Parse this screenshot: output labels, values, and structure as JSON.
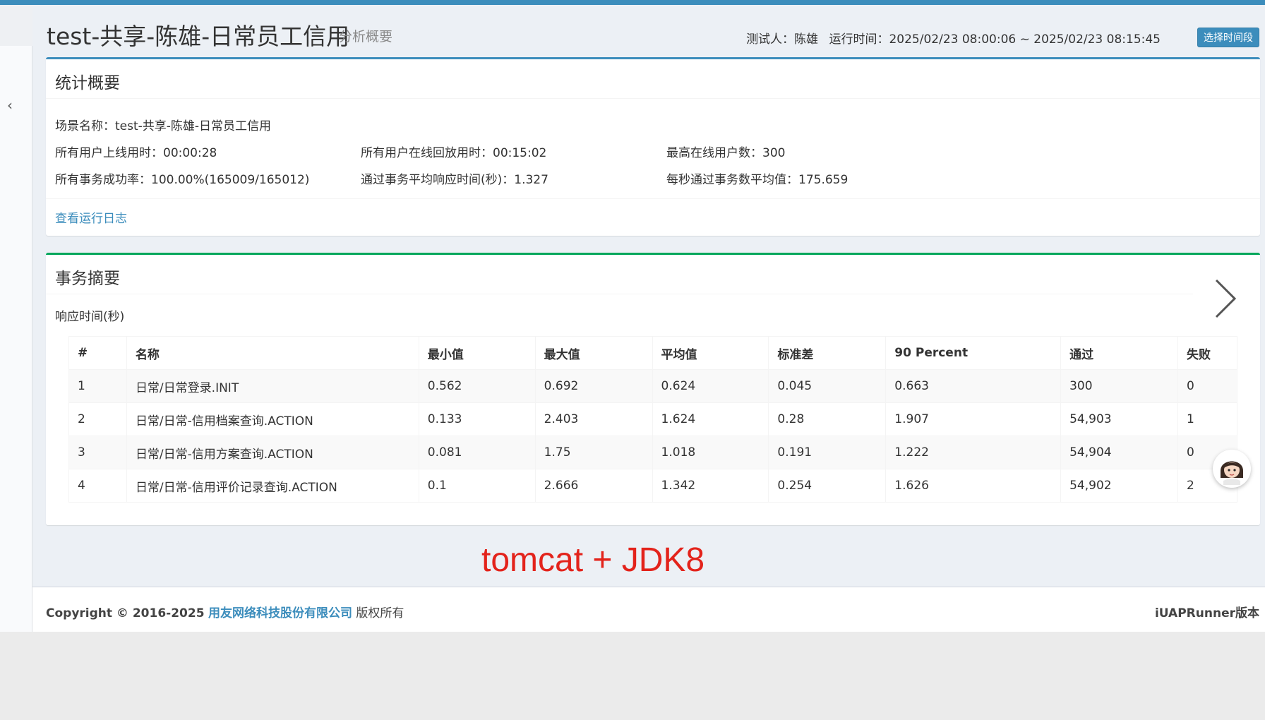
{
  "header": {
    "title": "test-共享-陈雄-日常员工信用",
    "subtitle": "分析概要",
    "tester": "测试人：陈雄",
    "run_time": "运行时间：2025/02/23 08:00:06 ~ 2025/02/23 08:15:45",
    "time_button": "选择时间段"
  },
  "summary": {
    "title": "统计概要",
    "scene": "场景名称：test-共享-陈雄-日常员工信用",
    "login_time": "所有用户上线用时：00:00:28",
    "online_time": "所有用户在线回放用时：00:15:02",
    "max_users": "最高在线用户数：300",
    "success_rate": "所有事务成功率：100.00%(165009/165012)",
    "avg_response": "通过事务平均响应时间(秒)：1.327",
    "tps": "每秒通过事务数平均值：175.659",
    "log_link": "查看运行日志"
  },
  "transactions": {
    "title": "事务摘要",
    "subtitle": "响应时间(秒)",
    "columns": [
      "#",
      "名称",
      "最小值",
      "最大值",
      "平均值",
      "标准差",
      "90 Percent",
      "通过",
      "失败"
    ],
    "rows": [
      [
        "1",
        "日常/日常登录.INIT",
        "0.562",
        "0.692",
        "0.624",
        "0.045",
        "0.663",
        "300",
        "0"
      ],
      [
        "2",
        "日常/日常-信用档案查询.ACTION",
        "0.133",
        "2.403",
        "1.624",
        "0.28",
        "1.907",
        "54,903",
        "1"
      ],
      [
        "3",
        "日常/日常-信用方案查询.ACTION",
        "0.081",
        "1.75",
        "1.018",
        "0.191",
        "1.222",
        "54,904",
        "0"
      ],
      [
        "4",
        "日常/日常-信用评价记录查询.ACTION",
        "0.1",
        "2.666",
        "1.342",
        "0.254",
        "1.626",
        "54,902",
        "2"
      ]
    ]
  },
  "annotation": "tomcat + JDK8",
  "footer": {
    "copyright": "Copyright © 2016-2025",
    "company": "用友网络科技股份有限公司",
    "rights": "版权所有",
    "version": "iUAPRunner版本"
  },
  "icons": {
    "collapse": "chevron-left-icon",
    "next": "chevron-right-icon",
    "assistant": "assistant-avatar-icon"
  },
  "colors": {
    "primary": "#3c8dbc",
    "success": "#00a65a",
    "annotation": "#e3231b"
  }
}
